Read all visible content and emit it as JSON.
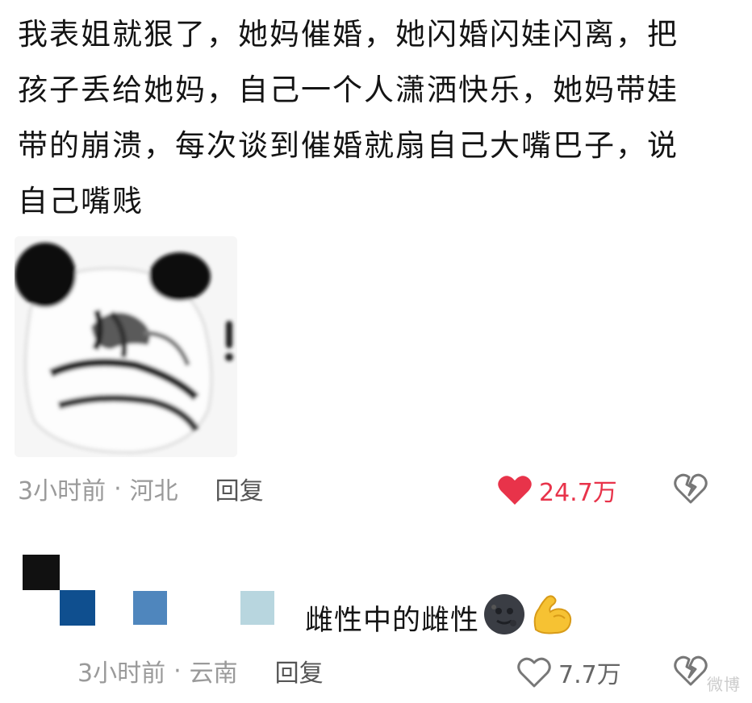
{
  "comment": {
    "lines": [
      "我表姐就狠了，她妈催婚，她闪婚闪娃闪离，把",
      "孩子丢给她妈，自己一个人潇洒快乐，她妈带娃",
      "带的崩溃，每次谈到催婚就扇自己大嘴巴子，说",
      "自己嘴贱"
    ],
    "sticker_icon": "panda-meme-sticker",
    "time": "3小时前",
    "separator": "·",
    "location": "河北",
    "reply_label": "回复",
    "like_count": "24.7万",
    "liked": true,
    "like_color": "#e8334a"
  },
  "sub_reply": {
    "avatar_icon": "pixelated-avatar",
    "text": "雌性中的雌性",
    "emojis": [
      "new-moon-face-emoji",
      "flexed-biceps-emoji"
    ],
    "time": "3小时前",
    "separator": "·",
    "location": "云南",
    "reply_label": "回复",
    "like_count": "7.7万",
    "liked": false
  },
  "watermark": "微博"
}
